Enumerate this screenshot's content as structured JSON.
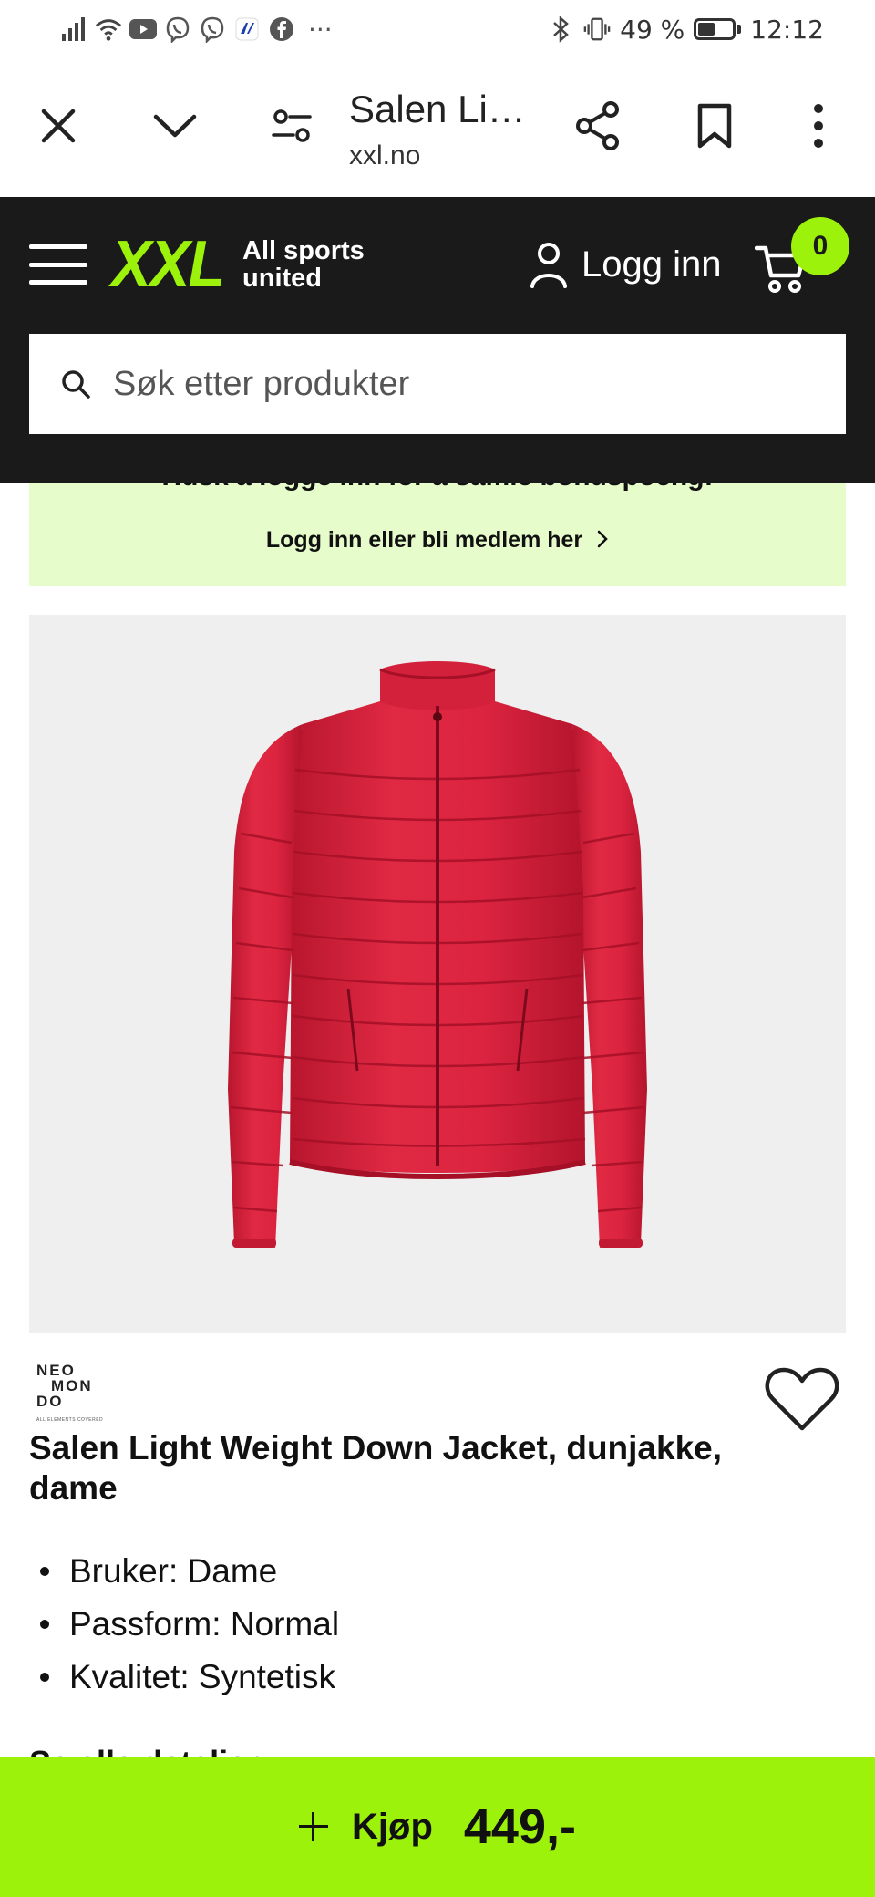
{
  "status_bar": {
    "battery_percent": "49 %",
    "battery_level": 0.49,
    "time": "12:12",
    "more_indicator": "···",
    "icons": [
      "signal-icon",
      "wifi-icon",
      "youtube-icon",
      "viber-icon",
      "viber-icon",
      "app-icon",
      "facebook-icon",
      "bluetooth-icon",
      "vibrate-icon",
      "battery-icon"
    ]
  },
  "browser": {
    "page_title": "Salen Li…",
    "url": "xxl.no",
    "icons": [
      "close-icon",
      "chevron-down-icon",
      "site-settings-icon",
      "share-icon",
      "bookmark-icon",
      "more-vert-icon"
    ]
  },
  "header": {
    "logo_text": "XXL",
    "tagline_line1": "All sports",
    "tagline_line2": "united",
    "login_label": "Logg inn",
    "cart_count": "0",
    "search_placeholder": "Søk etter produkter"
  },
  "promo": {
    "headline": "Husk å logge inn for å samle bonuspoeng!",
    "link_text": "Logg inn eller bli medlem her",
    "background_color": "#e6fccb"
  },
  "product": {
    "brand_line1": "NEO",
    "brand_line2": "MON",
    "brand_line3": "DO",
    "brand_tagline": "ALL ELEMENTS COVERED",
    "name": "Salen Light Weight Down Jacket, dunjakke, dame",
    "features": [
      "Bruker: Dame",
      "Passform: Normal",
      "Kvalitet: Syntetisk"
    ],
    "details_link": "Se alle detaljer",
    "jacket_color": "#d81f3a"
  },
  "buy_bar": {
    "buy_label": "Kjøp",
    "price": "449,-",
    "accent_color": "#9df20c"
  }
}
